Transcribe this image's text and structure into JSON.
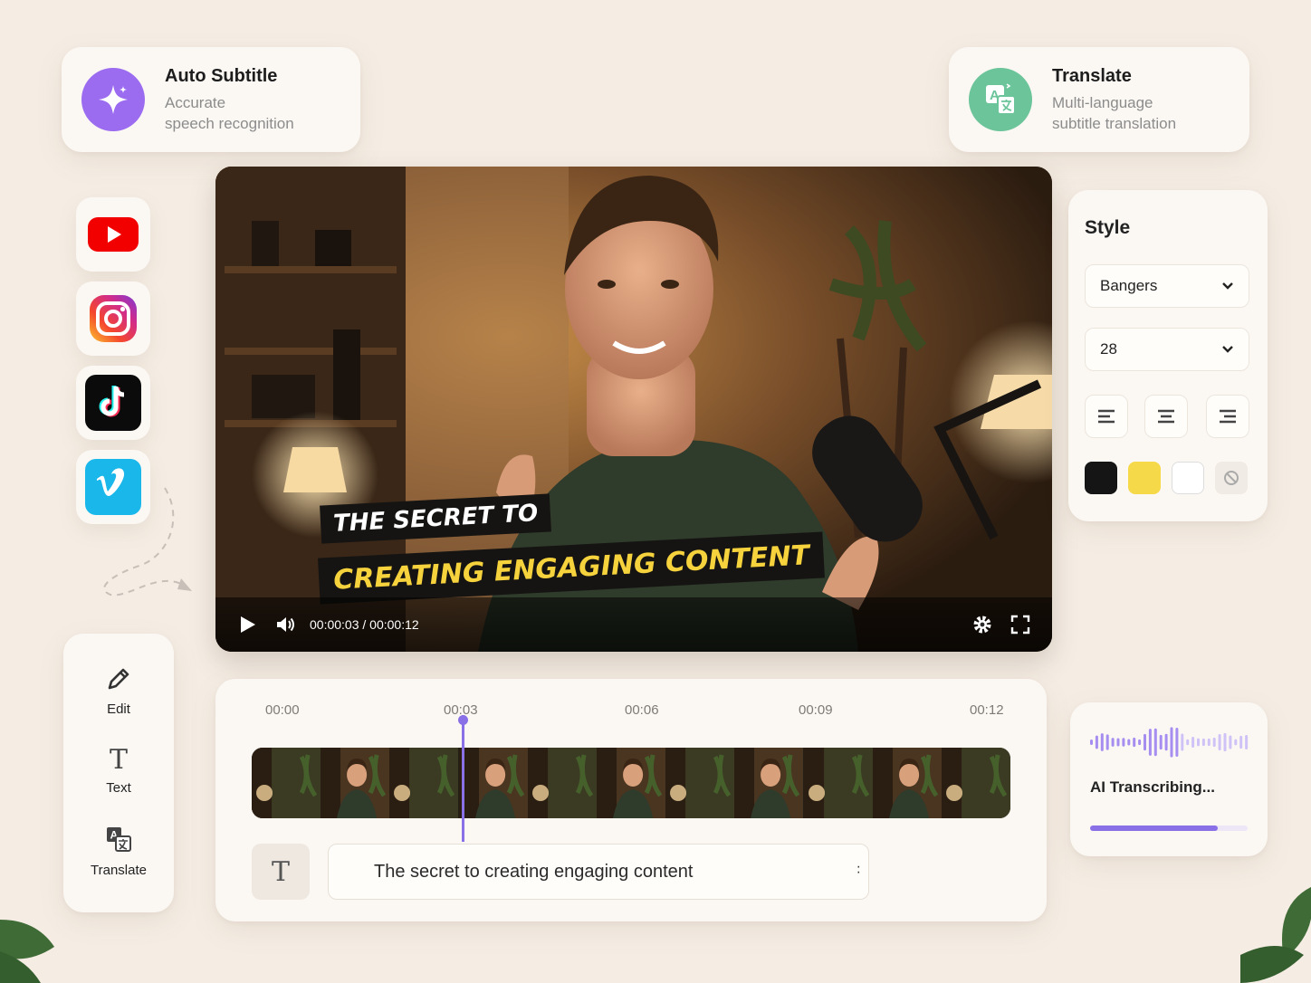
{
  "features": {
    "auto_subtitle": {
      "title": "Auto Subtitle",
      "desc": "Accurate\nspeech recognition",
      "color": "#9b6cf0"
    },
    "translate": {
      "title": "Translate",
      "desc": "Multi-language\nsubtitle translation",
      "color": "#6cc49a"
    }
  },
  "social": [
    "youtube-icon",
    "instagram-icon",
    "tiktok-icon",
    "vimeo-icon"
  ],
  "video": {
    "subtitle_line1": "THE SECRET TO",
    "subtitle_line2": "CREATING ENGAGING CONTENT",
    "time": "00:00:03 / 00:00:12",
    "icons": [
      "play-icon",
      "volume-icon",
      "settings-icon",
      "fullscreen-icon"
    ]
  },
  "style": {
    "title": "Style",
    "font": "Bangers",
    "size": "28",
    "align": [
      "left",
      "center",
      "right"
    ],
    "swatches": [
      "#151515",
      "#f6d949",
      "#ffffff",
      "none"
    ]
  },
  "tools": [
    {
      "label": "Edit",
      "icon": "pencil-icon"
    },
    {
      "label": "Text",
      "icon": "text-icon"
    },
    {
      "label": "Translate",
      "icon": "translate-icon"
    }
  ],
  "timeline": {
    "ticks": [
      "00:00",
      "00:03",
      "00:06",
      "00:09",
      "00:12"
    ],
    "subtitle_text": "The secret to creating engaging content",
    "text_glyph": "T",
    "playhead_time": "00:03"
  },
  "ai": {
    "label": "AI Transcribing...",
    "progress": 0.81,
    "accent": "#8a70e6"
  }
}
